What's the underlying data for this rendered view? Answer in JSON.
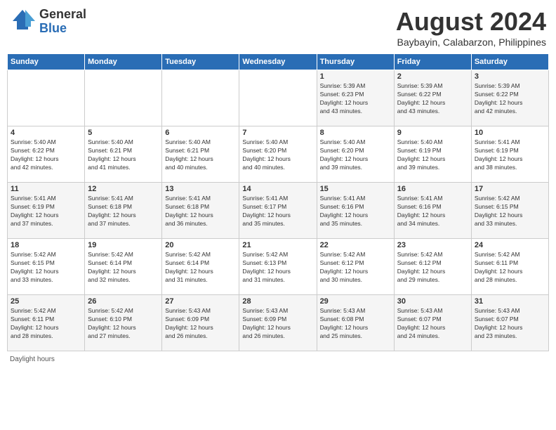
{
  "header": {
    "logo_general": "General",
    "logo_blue": "Blue",
    "month_year": "August 2024",
    "location": "Baybayin, Calabarzon, Philippines"
  },
  "days_of_week": [
    "Sunday",
    "Monday",
    "Tuesday",
    "Wednesday",
    "Thursday",
    "Friday",
    "Saturday"
  ],
  "footer": {
    "daylight_hours": "Daylight hours"
  },
  "weeks": [
    [
      {
        "day": "",
        "info": ""
      },
      {
        "day": "",
        "info": ""
      },
      {
        "day": "",
        "info": ""
      },
      {
        "day": "",
        "info": ""
      },
      {
        "day": "1",
        "info": "Sunrise: 5:39 AM\nSunset: 6:23 PM\nDaylight: 12 hours\nand 43 minutes."
      },
      {
        "day": "2",
        "info": "Sunrise: 5:39 AM\nSunset: 6:22 PM\nDaylight: 12 hours\nand 43 minutes."
      },
      {
        "day": "3",
        "info": "Sunrise: 5:39 AM\nSunset: 6:22 PM\nDaylight: 12 hours\nand 42 minutes."
      }
    ],
    [
      {
        "day": "4",
        "info": "Sunrise: 5:40 AM\nSunset: 6:22 PM\nDaylight: 12 hours\nand 42 minutes."
      },
      {
        "day": "5",
        "info": "Sunrise: 5:40 AM\nSunset: 6:21 PM\nDaylight: 12 hours\nand 41 minutes."
      },
      {
        "day": "6",
        "info": "Sunrise: 5:40 AM\nSunset: 6:21 PM\nDaylight: 12 hours\nand 40 minutes."
      },
      {
        "day": "7",
        "info": "Sunrise: 5:40 AM\nSunset: 6:20 PM\nDaylight: 12 hours\nand 40 minutes."
      },
      {
        "day": "8",
        "info": "Sunrise: 5:40 AM\nSunset: 6:20 PM\nDaylight: 12 hours\nand 39 minutes."
      },
      {
        "day": "9",
        "info": "Sunrise: 5:40 AM\nSunset: 6:19 PM\nDaylight: 12 hours\nand 39 minutes."
      },
      {
        "day": "10",
        "info": "Sunrise: 5:41 AM\nSunset: 6:19 PM\nDaylight: 12 hours\nand 38 minutes."
      }
    ],
    [
      {
        "day": "11",
        "info": "Sunrise: 5:41 AM\nSunset: 6:19 PM\nDaylight: 12 hours\nand 37 minutes."
      },
      {
        "day": "12",
        "info": "Sunrise: 5:41 AM\nSunset: 6:18 PM\nDaylight: 12 hours\nand 37 minutes."
      },
      {
        "day": "13",
        "info": "Sunrise: 5:41 AM\nSunset: 6:18 PM\nDaylight: 12 hours\nand 36 minutes."
      },
      {
        "day": "14",
        "info": "Sunrise: 5:41 AM\nSunset: 6:17 PM\nDaylight: 12 hours\nand 35 minutes."
      },
      {
        "day": "15",
        "info": "Sunrise: 5:41 AM\nSunset: 6:16 PM\nDaylight: 12 hours\nand 35 minutes."
      },
      {
        "day": "16",
        "info": "Sunrise: 5:41 AM\nSunset: 6:16 PM\nDaylight: 12 hours\nand 34 minutes."
      },
      {
        "day": "17",
        "info": "Sunrise: 5:42 AM\nSunset: 6:15 PM\nDaylight: 12 hours\nand 33 minutes."
      }
    ],
    [
      {
        "day": "18",
        "info": "Sunrise: 5:42 AM\nSunset: 6:15 PM\nDaylight: 12 hours\nand 33 minutes."
      },
      {
        "day": "19",
        "info": "Sunrise: 5:42 AM\nSunset: 6:14 PM\nDaylight: 12 hours\nand 32 minutes."
      },
      {
        "day": "20",
        "info": "Sunrise: 5:42 AM\nSunset: 6:14 PM\nDaylight: 12 hours\nand 31 minutes."
      },
      {
        "day": "21",
        "info": "Sunrise: 5:42 AM\nSunset: 6:13 PM\nDaylight: 12 hours\nand 31 minutes."
      },
      {
        "day": "22",
        "info": "Sunrise: 5:42 AM\nSunset: 6:12 PM\nDaylight: 12 hours\nand 30 minutes."
      },
      {
        "day": "23",
        "info": "Sunrise: 5:42 AM\nSunset: 6:12 PM\nDaylight: 12 hours\nand 29 minutes."
      },
      {
        "day": "24",
        "info": "Sunrise: 5:42 AM\nSunset: 6:11 PM\nDaylight: 12 hours\nand 28 minutes."
      }
    ],
    [
      {
        "day": "25",
        "info": "Sunrise: 5:42 AM\nSunset: 6:11 PM\nDaylight: 12 hours\nand 28 minutes."
      },
      {
        "day": "26",
        "info": "Sunrise: 5:42 AM\nSunset: 6:10 PM\nDaylight: 12 hours\nand 27 minutes."
      },
      {
        "day": "27",
        "info": "Sunrise: 5:43 AM\nSunset: 6:09 PM\nDaylight: 12 hours\nand 26 minutes."
      },
      {
        "day": "28",
        "info": "Sunrise: 5:43 AM\nSunset: 6:09 PM\nDaylight: 12 hours\nand 26 minutes."
      },
      {
        "day": "29",
        "info": "Sunrise: 5:43 AM\nSunset: 6:08 PM\nDaylight: 12 hours\nand 25 minutes."
      },
      {
        "day": "30",
        "info": "Sunrise: 5:43 AM\nSunset: 6:07 PM\nDaylight: 12 hours\nand 24 minutes."
      },
      {
        "day": "31",
        "info": "Sunrise: 5:43 AM\nSunset: 6:07 PM\nDaylight: 12 hours\nand 23 minutes."
      }
    ]
  ]
}
